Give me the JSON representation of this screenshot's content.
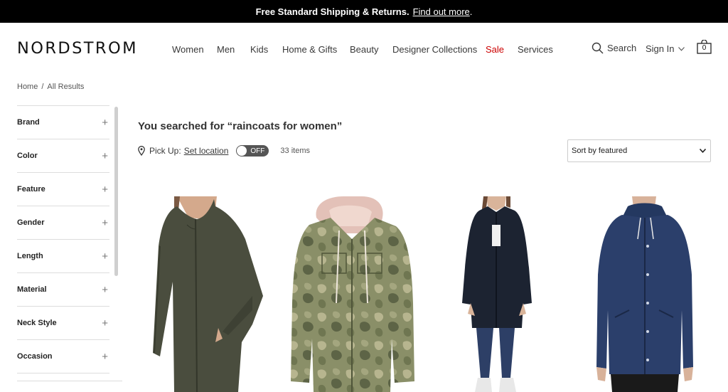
{
  "promo": {
    "text": "Free Standard Shipping & Returns.",
    "link": "Find out more",
    "end": "."
  },
  "header": {
    "logo": "NORDSTROM",
    "nav": [
      "Women",
      "Men",
      "Kids",
      "Home & Gifts",
      "Beauty",
      "Designer Collections",
      "Sale",
      "Services"
    ],
    "search_label": "Search",
    "signin_label": "Sign In",
    "bag_count": "0"
  },
  "breadcrumb": [
    "Home",
    "All Results"
  ],
  "filters": [
    "Brand",
    "Color",
    "Feature",
    "Gender",
    "Length",
    "Material",
    "Neck Style",
    "Occasion"
  ],
  "results": {
    "heading": "You searched for “raincoats for women”",
    "pickup_label": "Pick Up:",
    "set_location": "Set location",
    "toggle_state": "OFF",
    "count": "33 items",
    "sort_value": "Sort by featured"
  },
  "colors": {
    "sale": "#cc0000",
    "promo_bg": "#000000",
    "jacket_olive": "#4a4d3e",
    "jacket_camo": "#8a8f68",
    "jacket_navy_dark": "#1c2331",
    "jacket_blue": "#2b3f6b"
  }
}
